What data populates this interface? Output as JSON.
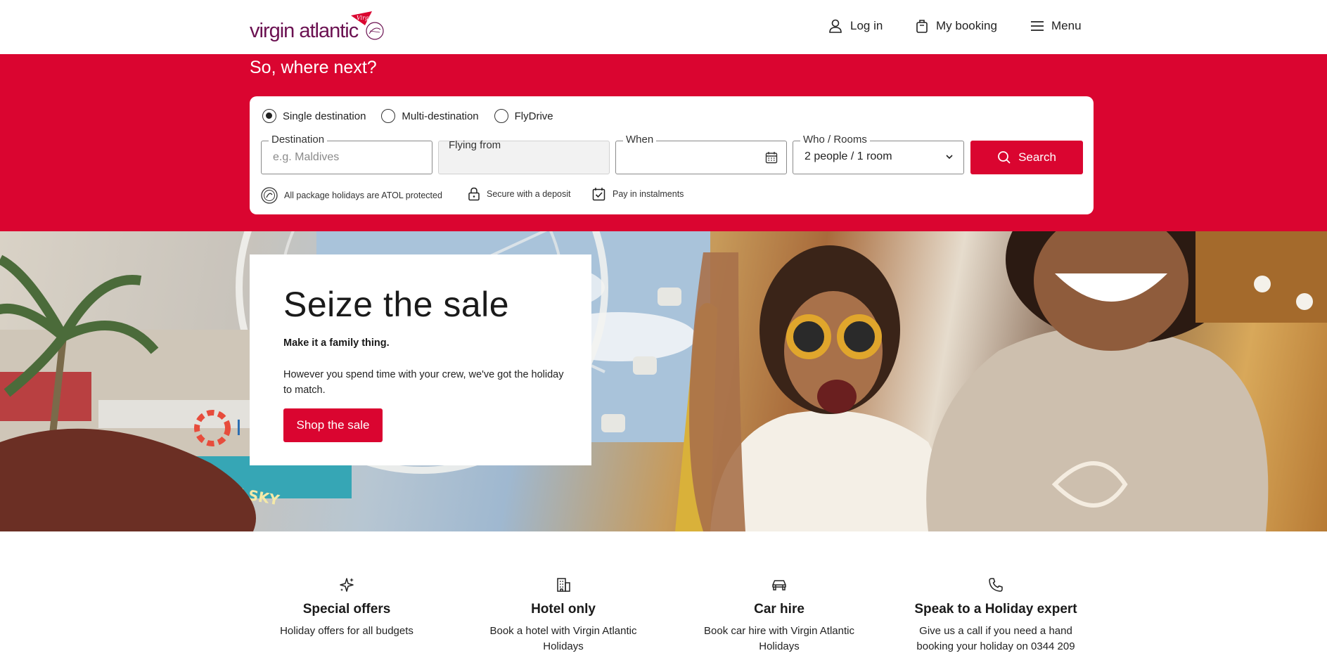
{
  "header": {
    "logo_text": "virgin atlantic",
    "nav": {
      "login": "Log in",
      "booking": "My booking",
      "menu": "Menu"
    }
  },
  "search": {
    "title": "So, where next?",
    "trip_types": [
      {
        "label": "Single destination",
        "checked": true
      },
      {
        "label": "Multi-destination",
        "checked": false
      },
      {
        "label": "FlyDrive",
        "checked": false
      }
    ],
    "destination": {
      "label": "Destination",
      "placeholder": "e.g. Maldives",
      "value": ""
    },
    "flying_from": {
      "label": "Flying from",
      "value": ""
    },
    "when": {
      "label": "When",
      "value": ""
    },
    "who_rooms": {
      "label": "Who / Rooms",
      "value": "2 people / 1 room"
    },
    "search_button": "Search",
    "assurances": [
      {
        "icon": "atol-icon",
        "text": "All package holidays are ATOL protected"
      },
      {
        "icon": "lock-icon",
        "text": "Secure with a deposit"
      },
      {
        "icon": "calendar-check-icon",
        "text": "Pay in instalments"
      }
    ]
  },
  "hero": {
    "title": "Seize the sale",
    "subtitle": "Make it a family thing.",
    "body": "However you spend time with your crew, we've got the holiday to match.",
    "button": "Shop the sale"
  },
  "features": [
    {
      "icon": "sparkles-icon",
      "title": "Special offers",
      "desc": "Holiday offers for all budgets"
    },
    {
      "icon": "hotel-icon",
      "title": "Hotel only",
      "desc": "Book a hotel with Virgin Atlantic Holidays"
    },
    {
      "icon": "car-icon",
      "title": "Car hire",
      "desc": "Book car hire with Virgin Atlantic Holidays"
    },
    {
      "icon": "phone-icon",
      "title": "Speak to a Holiday expert",
      "desc": "Give us a call if you need a hand booking your holiday on 0344 209"
    }
  ],
  "colors": {
    "brand_red": "#da0530",
    "logo_purple": "#6b1151"
  }
}
